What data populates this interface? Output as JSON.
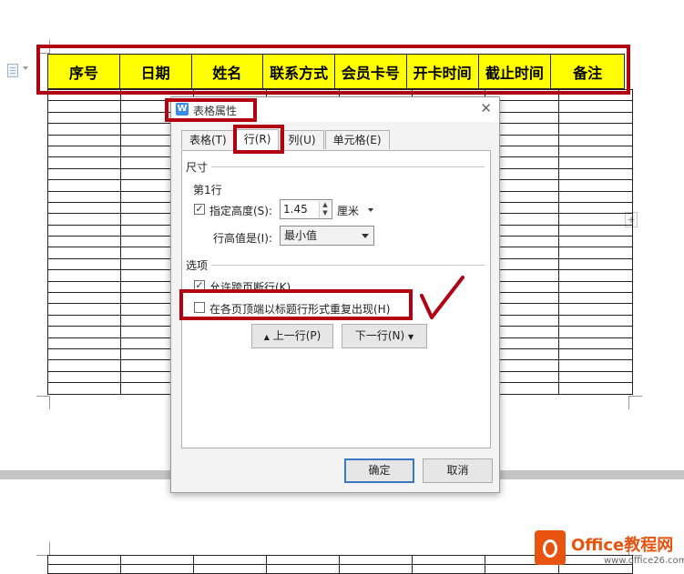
{
  "document": {
    "header_cells": [
      "序号",
      "日期",
      "姓名",
      "联系方式",
      "会员卡号",
      "开卡时间",
      "截止时间",
      "备注"
    ],
    "page_gap_color": "#c4c4c4",
    "header_fill": "#ffff00"
  },
  "dialog": {
    "title": "表格属性",
    "tabs": [
      {
        "label": "表格(T)",
        "active": false
      },
      {
        "label": "行(R)",
        "active": true
      },
      {
        "label": "列(U)",
        "active": false
      },
      {
        "label": "单元格(E)",
        "active": false
      }
    ],
    "size_section": "尺寸",
    "row_label": "第1行",
    "specify_height": {
      "label": "指定高度(S):",
      "checked": true,
      "value": "1.45",
      "unit": "厘米"
    },
    "row_height_mode": {
      "label": "行高值是(I):",
      "value": "最小值"
    },
    "options_section": "选项",
    "allow_break": {
      "label": "允许跨页断行(K)",
      "checked": true
    },
    "repeat_header": {
      "label": "在各页顶端以标题行形式重复出现(H)",
      "checked": false
    },
    "prev_row": "上一行(P)",
    "next_row": "下一行(N)",
    "ok": "确定",
    "cancel": "取消"
  },
  "watermark": {
    "brand": "Office教程网",
    "url": "www.office26.com"
  },
  "colors": {
    "highlight": "#b00012",
    "accent": "#3a78c6"
  }
}
